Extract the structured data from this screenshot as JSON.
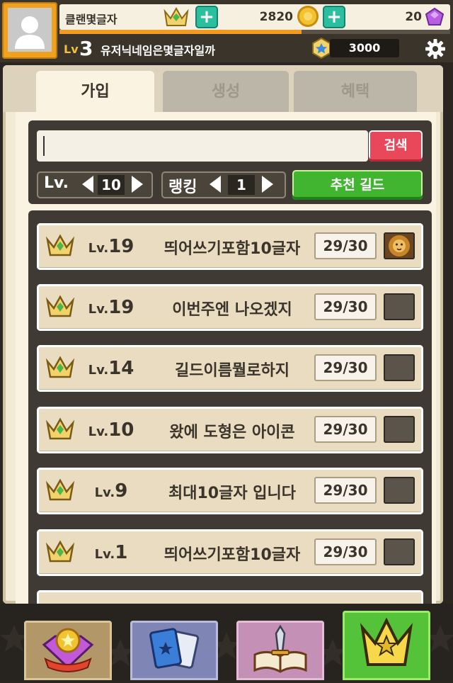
{
  "header": {
    "clan_name": "클랜몇글자",
    "gold": "2820",
    "gems": "20",
    "level_label": "Lv",
    "level": "3",
    "nickname": "유저닉네임은몇글자일까",
    "cash": "3000",
    "xp_progress": 0.62
  },
  "tabs": [
    {
      "label": "가입"
    },
    {
      "label": "생성"
    },
    {
      "label": "혜택"
    }
  ],
  "search": {
    "placeholder": "",
    "value": "",
    "button_label": "검색"
  },
  "filters": {
    "level_label": "Lv.",
    "level_value": "10",
    "ranking_label": "랭킹",
    "ranking_value": "1",
    "recommend_label": "추천 길드"
  },
  "guilds": [
    {
      "level_prefix": "Lv.",
      "level": "19",
      "name": "띄어쓰기포함10글자",
      "members": "29/30",
      "emblem": "lion-emblem-icon"
    },
    {
      "level_prefix": "Lv.",
      "level": "19",
      "name": "이번주엔 나오겠지",
      "members": "29/30",
      "emblem": "empty-emblem"
    },
    {
      "level_prefix": "Lv.",
      "level": "14",
      "name": "길드이름뭘로하지",
      "members": "29/30",
      "emblem": "empty-emblem"
    },
    {
      "level_prefix": "Lv.",
      "level": "10",
      "name": "왔에 도형은 아이콘",
      "members": "29/30",
      "emblem": "empty-emblem"
    },
    {
      "level_prefix": "Lv.",
      "level": "9",
      "name": "최대10글자 입니다",
      "members": "29/30",
      "emblem": "empty-emblem"
    },
    {
      "level_prefix": "Lv.",
      "level": "1",
      "name": "띄어쓰기포함10글자",
      "members": "29/30",
      "emblem": "empty-emblem"
    }
  ],
  "bottom_nav": [
    {
      "icon": "gem-shop-icon"
    },
    {
      "icon": "cards-icon"
    },
    {
      "icon": "quest-book-icon"
    },
    {
      "icon": "guild-crown-icon",
      "active": true
    }
  ],
  "colors": {
    "accent_green": "#41b52f",
    "search_red": "#e8485a",
    "plus_teal": "#2bbf9f",
    "xp_orange": "#f39a1e"
  }
}
